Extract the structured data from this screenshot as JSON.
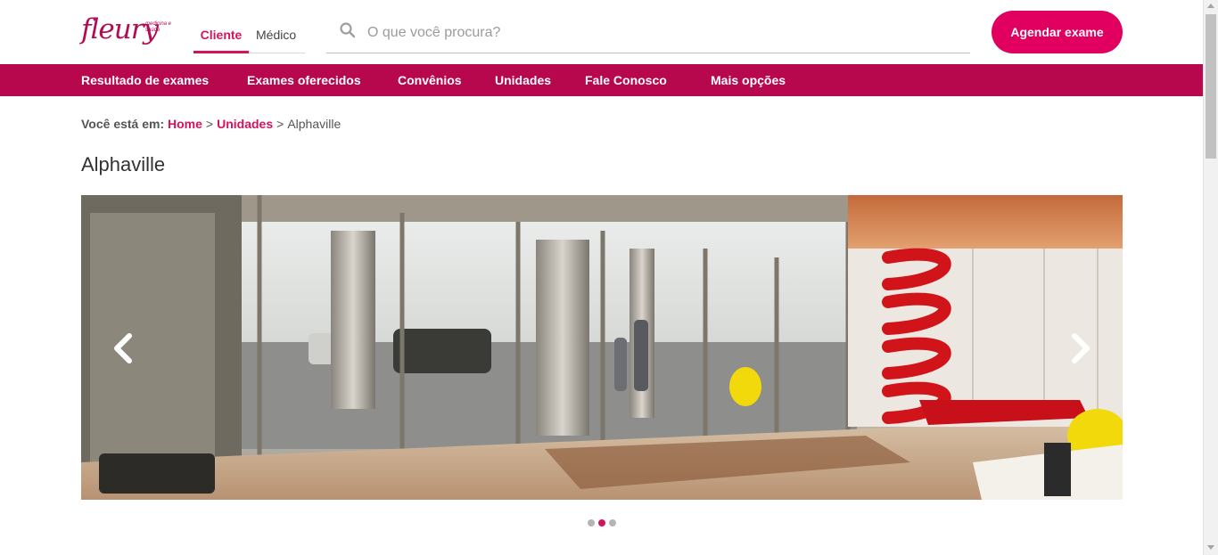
{
  "brand": {
    "logo_text": "fleury",
    "tagline": "medicina e saúde",
    "accent": "#d4145a",
    "nav_bg": "#b8084d"
  },
  "audience_tabs": [
    {
      "label": "Cliente",
      "active": true
    },
    {
      "label": "Médico",
      "active": false
    }
  ],
  "search": {
    "placeholder": "O que você procura?",
    "value": ""
  },
  "cta": {
    "label": "Agendar exame"
  },
  "nav": [
    {
      "label": "Resultado de exames"
    },
    {
      "label": "Exames oferecidos"
    },
    {
      "label": "Convênios"
    },
    {
      "label": "Unidades"
    },
    {
      "label": "Fale Conosco"
    },
    {
      "label": "Mais opções"
    }
  ],
  "breadcrumb": {
    "lead": "Você está em:",
    "items": [
      "Home",
      "Unidades"
    ],
    "separator": ">",
    "current": "Alphaville"
  },
  "page": {
    "title": "Alphaville"
  },
  "carousel": {
    "slide_count": 3,
    "active_index": 1,
    "icons": {
      "prev": "chevron-left-icon",
      "next": "chevron-right-icon"
    }
  },
  "icons": {
    "search": "search-icon"
  }
}
